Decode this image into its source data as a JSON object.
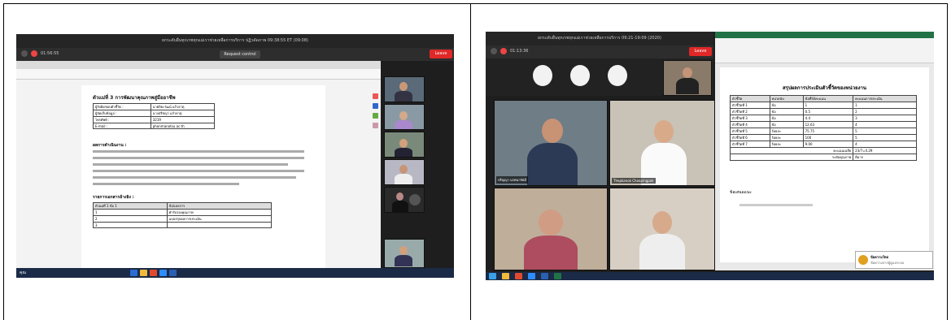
{
  "left": {
    "zoom_title": "ยกระดับอื่นทุกเรชทุกแม่เราช่วยเหลือการบริการ ปฏิวดัดภาพ 09:38:55 ET (09:08)",
    "rec_time": "01:56:55",
    "request_control": "Request control",
    "leave_label": "Leave",
    "doc_heading": "ตัวแม่ที่ 3 การพัฒนาคุณภาพสู่มืออาชีพ",
    "doc_rows": [
      {
        "k": "ผู้รับผิดชอบตัวชี้วัด :",
        "v": "นายปิยะวัฒน์ แก้วธาตุ"
      },
      {
        "k": "ผู้จัดเก็บข้อมูล :",
        "v": "นางปรีชญา แก้วธาตุ"
      },
      {
        "k": "โทรศัพท์ :",
        "v": "3219"
      },
      {
        "k": "E-mail :",
        "v": "phonmanatsu.ac.th"
      }
    ],
    "section_label": "ผลการดำเนินงาน :",
    "list_label": "รายการเอกสารอ้างอิง :",
    "list_cols": [
      "ตัวแม่ที่ 1 ข้อ 1",
      "ข้อ/เอกสาร"
    ],
    "list_items": [
      {
        "n": "1",
        "t": "คำรับรองคุณภาพ"
      },
      {
        "n": "2",
        "t": "แบบสรุปผลการประเมิน"
      },
      {
        "n": "3",
        "t": ""
      }
    ],
    "self_label": "คุณ"
  },
  "right": {
    "zoom_title": "ยกระดับอื่นทุกเรชทุกแม่เราช่วยเหลือการบริการ 09:21-19:09 (2020)",
    "rec_time": "01:13:36",
    "leave_label": "Leave",
    "speaker_label": "ปริญญา นรพนารัศมี",
    "speaker2_label": "Thepkanok Choopingpok",
    "sheet_title": "สรุปผลการประเมินตัวชี้วัดของหน่วยงาน",
    "sheet_cols": [
      "ตัวชี้วัด",
      "หน่วยนับ",
      "ข้อที่ได้คะแนน",
      "คะแนนการประเมิน"
    ],
    "sheet_rows": [
      {
        "a": "ตัวชี้วัดที่ 1",
        "b": "ข้อ",
        "c": "1",
        "d": "1"
      },
      {
        "a": "ตัวชี้วัดที่ 2",
        "b": "ข้อ",
        "c": "0.5",
        "d": "2"
      },
      {
        "a": "ตัวชี้วัดที่ 3",
        "b": "ข้อ",
        "c": "4.4",
        "d": "3"
      },
      {
        "a": "ตัวชี้วัดที่ 4",
        "b": "ข้อ",
        "c": "12.63",
        "d": "4"
      },
      {
        "a": "ตัวชี้วัดที่ 5",
        "b": "ร้อยละ",
        "c": "75.75",
        "d": "5"
      },
      {
        "a": "ตัวชี้วัดที่ 6",
        "b": "ร้อยละ",
        "c": "100",
        "d": "5"
      },
      {
        "a": "ตัวชี้วัดที่ 7",
        "b": "ร้อยละ",
        "c": "9.00",
        "d": "4"
      }
    ],
    "total_label": "คะแนนเฉลี่ย",
    "total_value": "23/7=4.29",
    "result_label": "ระดับคุณภาพ",
    "result_value": "ดีมาก",
    "footer_label": "ข้อเสนอแนะ",
    "notif_title": "ข้อความใหม่",
    "notif_sub": "ข้อความจากผู้ดูแลระบบ"
  }
}
